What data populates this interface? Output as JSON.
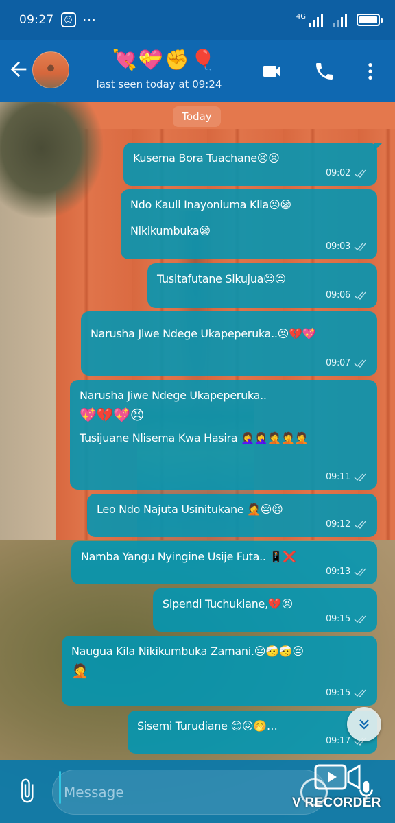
{
  "status_bar": {
    "time": "09:27",
    "app_badge": "☺",
    "overflow": "···",
    "network": "4G"
  },
  "header": {
    "contact_name": "💘💝✊🎈",
    "last_seen": "last seen today at 09:24",
    "icons": [
      "back-arrow-icon",
      "video-call-icon",
      "voice-call-icon",
      "more-options-icon"
    ]
  },
  "chat": {
    "date_label": "Today",
    "messages": [
      {
        "lines": [
          "Kusema Bora Tuachane😣😣"
        ],
        "time": "09:02"
      },
      {
        "lines": [
          "Ndo Kauli Inayoniuma Kila😣😪",
          "Nikikumbuka😪"
        ],
        "time": "09:03"
      },
      {
        "lines": [
          "Tusitafutane Sikujua😔😔"
        ],
        "time": "09:06"
      },
      {
        "lines": [
          "Narusha Jiwe Ndege Ukapeperuka..😣💔💖"
        ],
        "time": "09:07"
      },
      {
        "lines": [
          "Narusha Jiwe Ndege Ukapeperuka..",
          "💖💔💖😣",
          "Tusijuane Nlisema Kwa Hasira 🤦‍♀️🤦‍♀️🤦🤦🤦"
        ],
        "time": "09:11"
      },
      {
        "lines": [
          "Leo Ndo Najuta Usinitukane 🤦😔😣"
        ],
        "time": "09:12"
      },
      {
        "lines": [
          "Namba Yangu Nyingine Usije Futa.. 📱❌"
        ],
        "time": "09:13"
      },
      {
        "lines": [
          "Sipendi Tuchukiane,💔😣"
        ],
        "time": "09:15"
      },
      {
        "lines": [
          "Naugua Kila Nikikumbuka Zamani.😔🤕🤕😔",
          "🤦"
        ],
        "time": "09:15"
      },
      {
        "lines": [
          "Sisemi Turudiane 😊😖🤭…"
        ],
        "time": "09:17"
      }
    ]
  },
  "input": {
    "placeholder": "Message",
    "icons": [
      "attach-icon",
      "camera-icon",
      "mic-icon"
    ]
  },
  "watermark": {
    "label": "V RECORDER"
  },
  "colors": {
    "status_bar": "#0d5fa3",
    "header": "#0f68b1",
    "bubble": "#0096b4",
    "date_chip": "#eb916e"
  }
}
